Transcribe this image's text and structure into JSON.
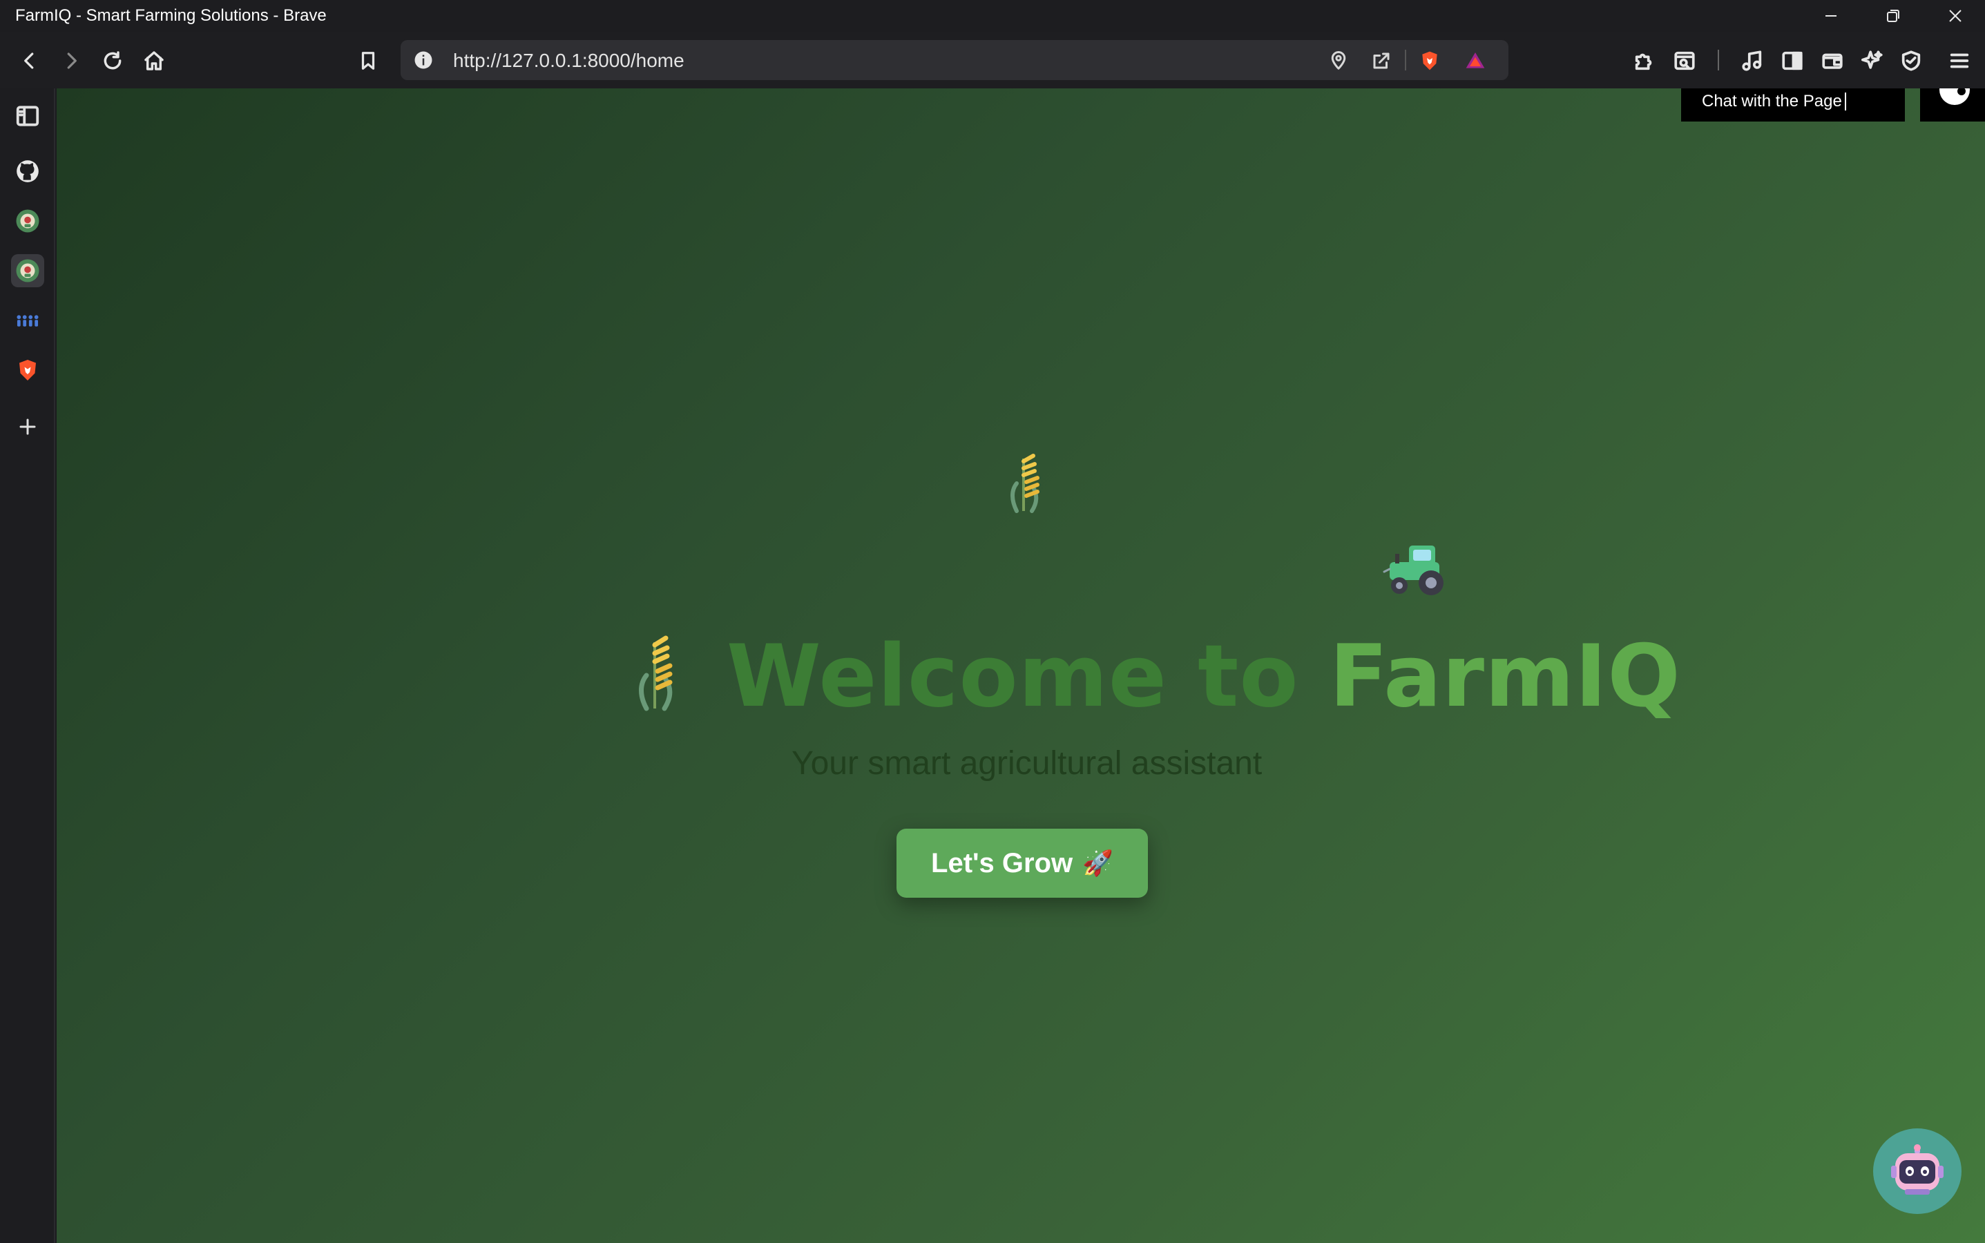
{
  "window": {
    "title": "FarmIQ - Smart Farming Solutions - Brave"
  },
  "toolbar": {
    "url": "http://127.0.0.1:8000/home"
  },
  "page": {
    "hero": {
      "title_part1": "Welcome to ",
      "title_part2": "FarmIQ",
      "subtitle": "Your smart agricultural assistant",
      "cta_label": "Let's Grow",
      "cta_emoji": "🚀"
    },
    "chat": {
      "bubble_text": "Chat with the Page"
    }
  },
  "colors": {
    "title_primary": "#3c7d35",
    "title_brand": "#5faa4c",
    "cta_bg": "#5ea95a",
    "bot_bg": "#4da395"
  },
  "icons": {
    "sidebar": [
      "sidebar-panel-icon",
      "github-icon",
      "farmiq-favicon-icon",
      "farmiq-favicon-icon",
      "people-icon",
      "brave-icon",
      "plus-icon"
    ],
    "toolbar": [
      "back-icon",
      "forward-icon",
      "reload-icon",
      "home-icon",
      "bookmark-icon",
      "location-icon",
      "share-icon",
      "brave-shields-icon",
      "rewards-icon",
      "extensions-icon",
      "screenshot-icon",
      "media-icon",
      "sidebar-toggle-icon",
      "wallet-icon",
      "leo-ai-icon",
      "vpn-icon",
      "menu-icon"
    ]
  }
}
